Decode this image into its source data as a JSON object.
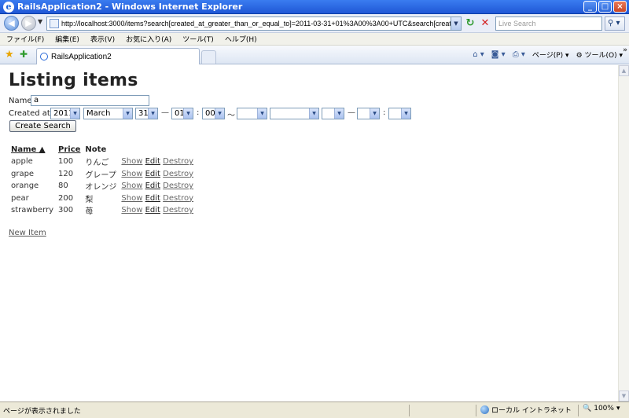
{
  "window": {
    "title": "RailsApplication2 - Windows Internet Explorer",
    "app_icon": "ie-icon"
  },
  "address_bar": {
    "url": "http://localhost:3000/items?search[created_at_greater_than_or_equal_to]=2011-03-31+01%3A00%3A00+UTC&search[created_at_less_than_or_e",
    "search_placeholder": "Live Search"
  },
  "menu": {
    "items": [
      "ファイル(F)",
      "編集(E)",
      "表示(V)",
      "お気に入り(A)",
      "ツール(T)",
      "ヘルプ(H)"
    ]
  },
  "tabs": {
    "active_label": "RailsApplication2"
  },
  "command_bar": {
    "page_label": "ページ(P)",
    "tools_label": "ツール(O)"
  },
  "page": {
    "title": "Listing items",
    "name_label": "Name",
    "name_value": "a",
    "created_at_label": "Created at",
    "from": {
      "year": "2011",
      "month": "March",
      "day": "31",
      "hour": "01",
      "minute": "00"
    },
    "dash": "—",
    "colon": ":",
    "tilde": "～",
    "create_search_label": "Create Search",
    "table": {
      "headers": {
        "name": "Name ▲",
        "price": "Price",
        "note": "Note"
      },
      "rows": [
        {
          "name": "apple",
          "price": "100",
          "note": "りんご"
        },
        {
          "name": "grape",
          "price": "120",
          "note": "グレープ"
        },
        {
          "name": "orange",
          "price": "80",
          "note": "オレンジ"
        },
        {
          "name": "pear",
          "price": "200",
          "note": "梨"
        },
        {
          "name": "strawberry",
          "price": "300",
          "note": "苺"
        }
      ],
      "show_label": "Show",
      "edit_label": "Edit",
      "destroy_label": "Destroy"
    },
    "new_item_label": "New Item"
  },
  "status_bar": {
    "message": "ページが表示されました",
    "zone": "ローカル イントラネット",
    "zoom": "100%"
  }
}
